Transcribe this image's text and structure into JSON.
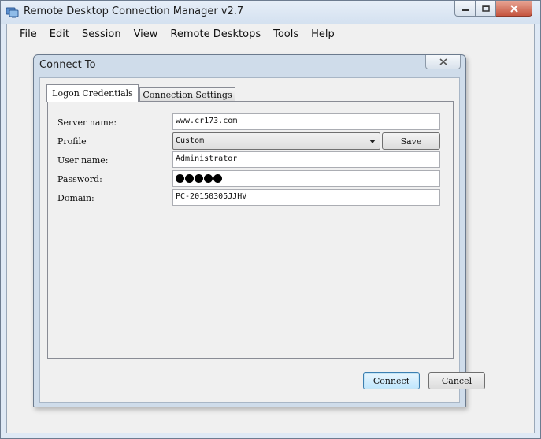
{
  "window": {
    "title": "Remote Desktop Connection Manager v2.7",
    "icon": "rdcman-app-icon"
  },
  "menu": {
    "items": [
      {
        "label": "File"
      },
      {
        "label": "Edit"
      },
      {
        "label": "Session"
      },
      {
        "label": "View"
      },
      {
        "label": "Remote Desktops"
      },
      {
        "label": "Tools"
      },
      {
        "label": "Help"
      }
    ]
  },
  "dialog": {
    "title": "Connect To",
    "tabs": [
      {
        "label": "Logon Credentials",
        "selected": true
      },
      {
        "label": "Connection Settings",
        "selected": false
      }
    ],
    "fields": {
      "server_name": {
        "label": "Server name:",
        "value": "www.cr173.com"
      },
      "profile": {
        "label": "Profile",
        "value": "Custom",
        "save_label": "Save"
      },
      "user_name": {
        "label": "User name:",
        "value": "Administrator"
      },
      "password": {
        "label": "Password:",
        "masked_length": 5
      },
      "domain": {
        "label": "Domain:",
        "value": "PC-20150305JJHV"
      }
    },
    "buttons": {
      "connect": "Connect",
      "cancel": "Cancel"
    }
  },
  "colors": {
    "window_frame": "#dfe9f5",
    "dialog_frame": "#cfdcea",
    "close_button": "#c5553f",
    "default_button_border": "#3c7fb1"
  }
}
